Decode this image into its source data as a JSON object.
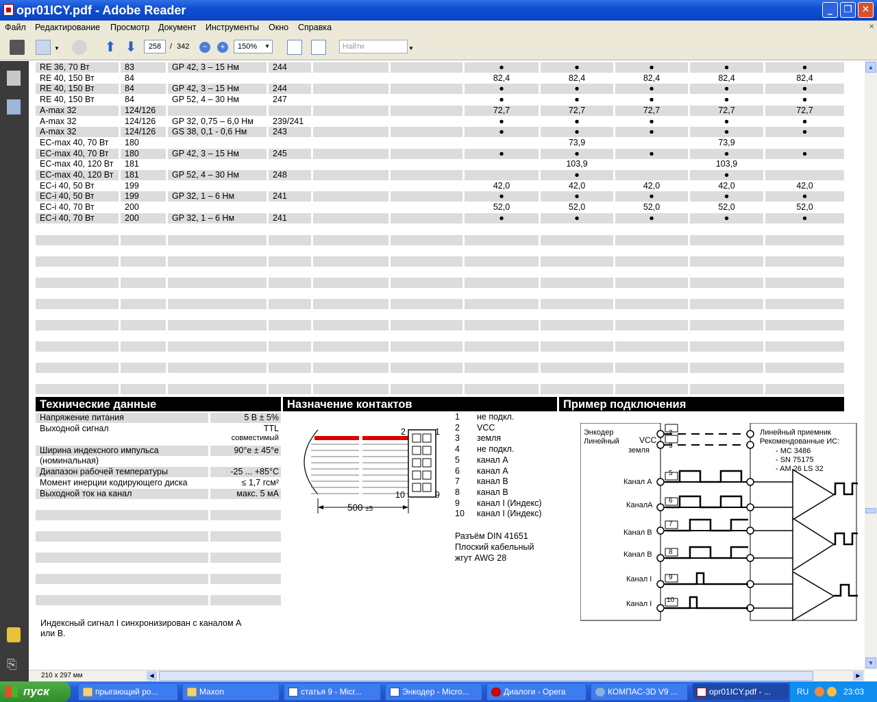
{
  "window": {
    "title": "opr01ICY.pdf - Adobe Reader"
  },
  "menu": [
    "Файл",
    "Редактирование",
    "Просмотр",
    "Документ",
    "Инструменты",
    "Окно",
    "Справка"
  ],
  "toolbar": {
    "page_current": "258",
    "page_sep": "/",
    "page_total": "342",
    "zoom": "150%",
    "search_placeholder": "Найти"
  },
  "status": {
    "page_size": "210 x 297 мм"
  },
  "table": {
    "rows": [
      {
        "motor": "RE 36, 70 Вт",
        "page": "83",
        "gear": "GP 42, 3 – 15 Нм",
        "gp": "244",
        "vals": [
          "●",
          "●",
          "●",
          "●",
          "●"
        ]
      },
      {
        "motor": "RE 40, 150 Вт",
        "page": "84",
        "gear": "",
        "gp": "",
        "vals": [
          "82,4",
          "82,4",
          "82,4",
          "82,4",
          "82,4"
        ]
      },
      {
        "motor": "RE 40, 150 Вт",
        "page": "84",
        "gear": "GP 42, 3 – 15 Нм",
        "gp": "244",
        "vals": [
          "●",
          "●",
          "●",
          "●",
          "●"
        ]
      },
      {
        "motor": "RE 40, 150 Вт",
        "page": "84",
        "gear": "GP 52, 4 – 30 Нм",
        "gp": "247",
        "vals": [
          "●",
          "●",
          "●",
          "●",
          "●"
        ]
      },
      {
        "motor": "A-max 32",
        "page": "124/126",
        "gear": "",
        "gp": "",
        "vals": [
          "72,7",
          "72,7",
          "72,7",
          "72,7",
          "72,7"
        ]
      },
      {
        "motor": "A-max 32",
        "page": "124/126",
        "gear": "GP 32, 0,75 – 6,0 Нм",
        "gp": "239/241",
        "vals": [
          "●",
          "●",
          "●",
          "●",
          "●"
        ]
      },
      {
        "motor": "A-max 32",
        "page": "124/126",
        "gear": "GS 38, 0,1 - 0,6 Нм",
        "gp": "243",
        "vals": [
          "●",
          "●",
          "●",
          "●",
          "●"
        ]
      },
      {
        "motor": "EC-max 40, 70 Вт",
        "page": "180",
        "gear": "",
        "gp": "",
        "vals": [
          "",
          "73,9",
          "",
          "73,9",
          ""
        ]
      },
      {
        "motor": "EC-max 40, 70 Вт",
        "page": "180",
        "gear": "GP 42, 3 – 15 Нм",
        "gp": "245",
        "vals": [
          "●",
          "●",
          "●",
          "●",
          "●"
        ]
      },
      {
        "motor": "EC-max 40, 120 Вт",
        "page": "181",
        "gear": "",
        "gp": "",
        "vals": [
          "",
          "103,9",
          "",
          "103,9",
          ""
        ]
      },
      {
        "motor": "EC-max 40, 120 Вт",
        "page": "181",
        "gear": "GP 52, 4 – 30 Нм",
        "gp": "248",
        "vals": [
          "",
          "●",
          "",
          "●",
          ""
        ]
      },
      {
        "motor": "EC-i 40, 50 Вт",
        "page": "199",
        "gear": "",
        "gp": "",
        "vals": [
          "42,0",
          "42,0",
          "42,0",
          "42,0",
          "42,0"
        ]
      },
      {
        "motor": "EC-i 40, 50 Вт",
        "page": "199",
        "gear": "GP 32, 1 – 6 Нм",
        "gp": "241",
        "vals": [
          "●",
          "●",
          "●",
          "●",
          "●"
        ]
      },
      {
        "motor": "EC-i 40, 70 Вт",
        "page": "200",
        "gear": "",
        "gp": "",
        "vals": [
          "52,0",
          "52,0",
          "52,0",
          "52,0",
          "52,0"
        ]
      },
      {
        "motor": "EC-i 40, 70 Вт",
        "page": "200",
        "gear": "GP 32, 1 – 6 Нм",
        "gp": "241",
        "vals": [
          "●",
          "●",
          "●",
          "●",
          "●"
        ]
      }
    ]
  },
  "tech": {
    "title": "Технические данные",
    "rows": [
      {
        "label": "Напряжение питания",
        "value": "5 В ± 5%"
      },
      {
        "label": "Выходной сигнал",
        "value": "TTL",
        "value2": "совместимый"
      },
      {
        "label": "Ширина индексного импульса",
        "label2": "(номинальная)",
        "value": "90°e ± 45°e"
      },
      {
        "label": "Диапазон рабочей температуры",
        "value": "-25 ... +85°C"
      },
      {
        "label": "Момент инерции кодирующего диска",
        "value": "≤ 1,7 гсм²"
      },
      {
        "label": "Выходной ток на канал",
        "value": "макс. 5 мА"
      }
    ],
    "note": "Индексный сигнал I синхронизирован с каналом А",
    "note2": "или B."
  },
  "pins": {
    "title": "Назначение контактов",
    "list": [
      {
        "n": "1",
        "t": "не подкл."
      },
      {
        "n": "2",
        "t": "VCC"
      },
      {
        "n": "3",
        "t": "земля"
      },
      {
        "n": "4",
        "t": "не подкл."
      },
      {
        "n": "5",
        "t": "канал A"
      },
      {
        "n": "6",
        "t": "канал A"
      },
      {
        "n": "7",
        "t": "канал B"
      },
      {
        "n": "8",
        "t": "канал B"
      },
      {
        "n": "9",
        "t": "канал I (Индекс)"
      },
      {
        "n": "10",
        "t": "канал I (Индекс)"
      }
    ],
    "conn1": "Разъём DIN 41651",
    "conn2": "Плоский кабельный",
    "conn3": "жгут AWG 28",
    "len": "500",
    "tol": "±5",
    "c_top1": "2",
    "c_top2": "1",
    "c_bot1": "10",
    "c_bot2": "9"
  },
  "example": {
    "title": "Пример подключения",
    "enc1": "Энкодер",
    "enc2": "Линейный",
    "vcc": "VCC",
    "gnd": "земля",
    "rcv1": "Линейный приемник",
    "rcv2": "Рекомендованные ИС:",
    "ic1": "- MC 3486",
    "ic2": "- SN 75175",
    "ic3": "- AM 26 LS 32",
    "chA": "Канал A",
    "chAn": "КаналA",
    "chB": "Канал B",
    "chBn": "Канал B",
    "chI": "Канал I",
    "chIn": "Канал I",
    "p2": "2",
    "p3": "3",
    "p5": "5",
    "p6": "6",
    "p7": "7",
    "p8": "8",
    "p9": "9",
    "p10": "10"
  },
  "taskbar": {
    "start": "пуск",
    "tasks": [
      "прыгающий ро...",
      "Maxon",
      "статья 9 - Micr...",
      "Энкодер - Micro...",
      "Диалоги - Opera",
      "КОМПАС-3D V9 ...",
      "opr01ICY.pdf - ..."
    ],
    "lang": "RU",
    "time": "23:03"
  }
}
